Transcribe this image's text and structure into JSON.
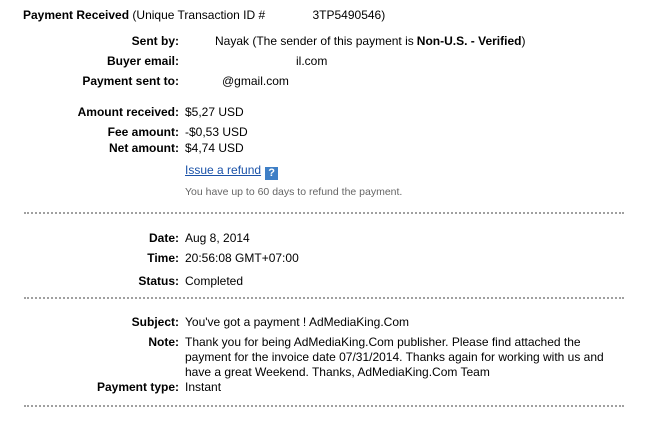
{
  "header": {
    "title": "Payment Received",
    "transaction_prefix": "(Unique Transaction ID #",
    "transaction_id": "3TP5490546)"
  },
  "details": {
    "sent_by_label": "Sent by:",
    "sent_by_name": "Nayak",
    "sent_by_note_prefix": "(The sender of this payment is",
    "sent_by_note_status": "Non-U.S. - Verified",
    "sent_by_note_suffix": ")",
    "buyer_email_label": "Buyer email:",
    "buyer_email_value": "il.com",
    "payment_sent_to_label": "Payment sent to:",
    "payment_sent_to_value": "@gmail.com"
  },
  "amounts": {
    "amount_received_label": "Amount received:",
    "amount_received_value": "$5,27 USD",
    "fee_amount_label": "Fee amount:",
    "fee_amount_value": "-$0,53 USD",
    "net_amount_label": "Net amount:",
    "net_amount_value": "$4,74 USD",
    "issue_refund_label": "Issue a refund",
    "help_icon_glyph": "?",
    "refund_note": "You have up to 60 days to refund the payment."
  },
  "timing": {
    "date_label": "Date:",
    "date_value": "Aug 8, 2014",
    "time_label": "Time:",
    "time_value": "20:56:08 GMT+07:00",
    "status_label": "Status:",
    "status_value": "Completed"
  },
  "message": {
    "subject_label": "Subject:",
    "subject_value": "You've got a payment ! AdMediaKing.Com",
    "note_label": "Note:",
    "note_value": "Thank you for being AdMediaKing.Com publisher. Please find attached the payment for the invoice date 07/31/2014. Thanks again for working with us and have a great Weekend. Thanks, AdMediaKing.Com Team",
    "payment_type_label": "Payment type:",
    "payment_type_value": "Instant"
  },
  "colors": {
    "link": "#1a52a8",
    "help_icon_bg": "#3f7fc6",
    "separator": "#a0a0a0",
    "muted_text": "#666666"
  }
}
